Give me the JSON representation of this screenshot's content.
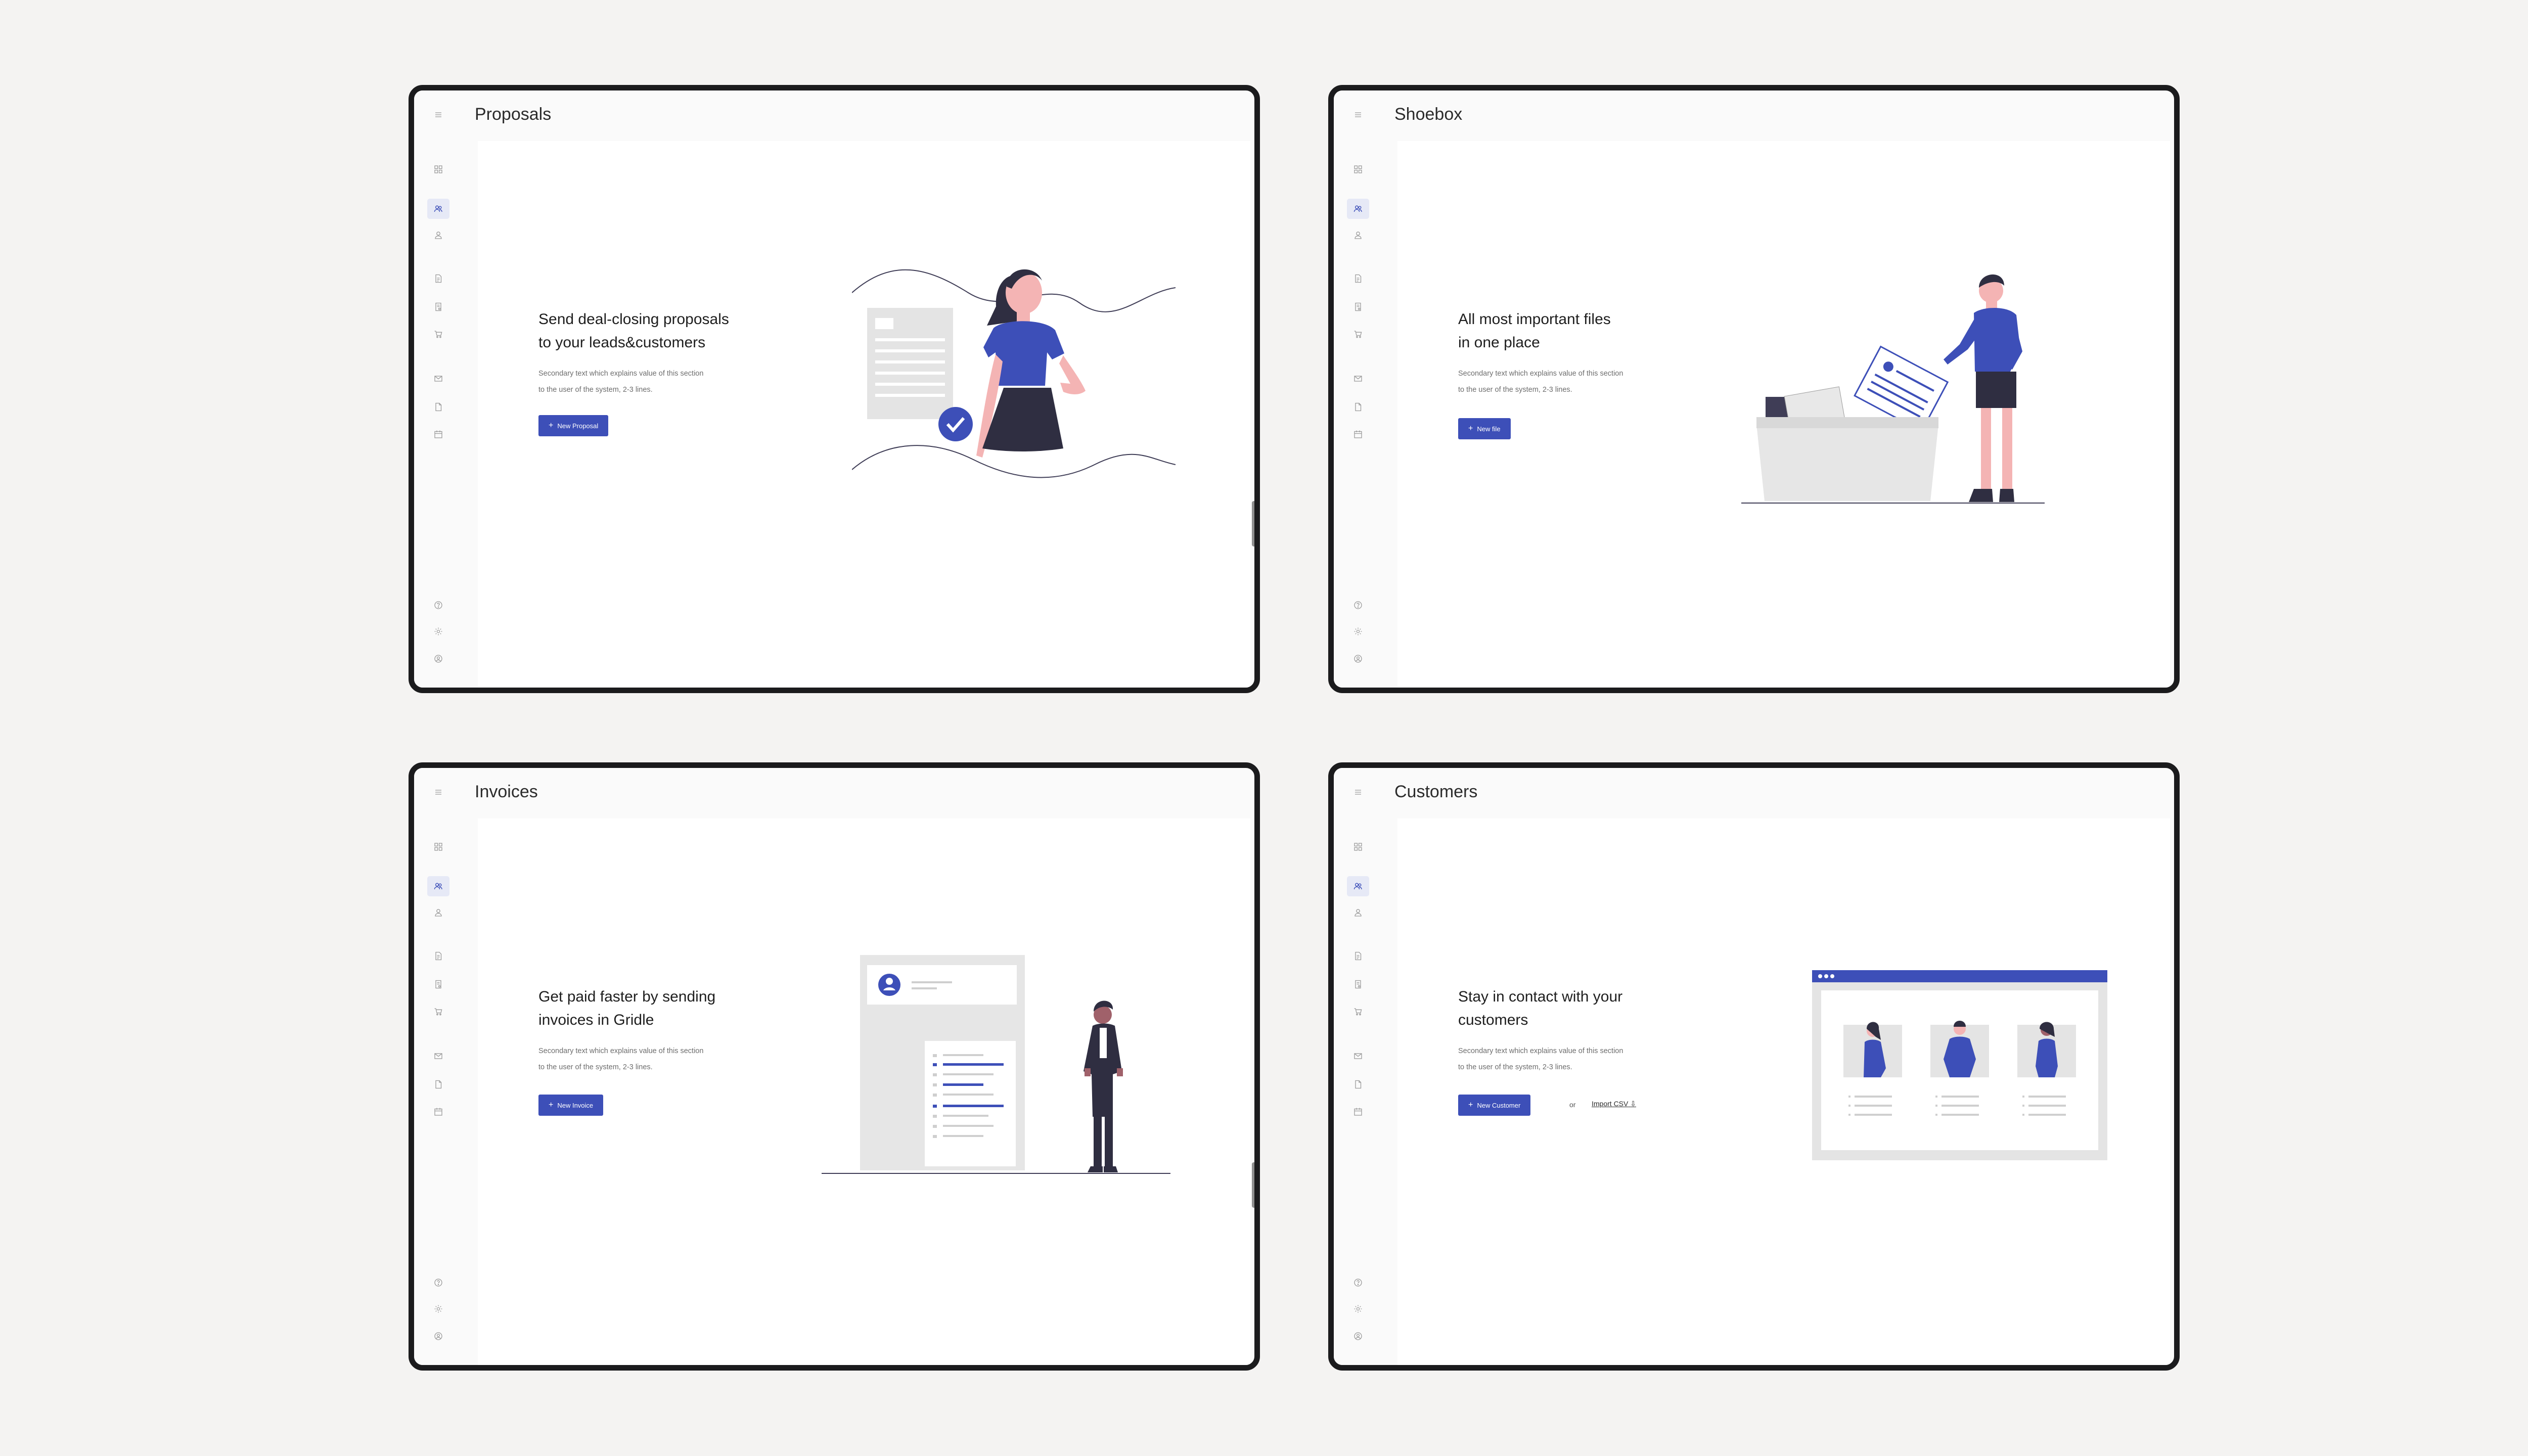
{
  "screens": [
    {
      "title": "Proposals",
      "headline": [
        "Send deal-closing proposals",
        "to your leads&customers"
      ],
      "secondary": [
        "Secondary text which explains value of this section",
        "to the user of the system, 2-3 lines."
      ],
      "button_label": "New Proposal"
    },
    {
      "title": "Shoebox",
      "headline": [
        "All most important files",
        "in one place"
      ],
      "secondary": [
        "Secondary text which explains value of this section",
        "to the user of the system, 2-3 lines."
      ],
      "button_label": "New file"
    },
    {
      "title": "Invoices",
      "headline": [
        "Get paid faster by sending",
        "invoices in Gridle"
      ],
      "secondary": [
        "Secondary text which explains value of this section",
        "to the user of the system, 2-3 lines."
      ],
      "button_label": "New Invoice"
    },
    {
      "title": "Customers",
      "headline": [
        "Stay in contact with your",
        "customers"
      ],
      "secondary": [
        "Secondary text which explains value of this section",
        "to the user of the system, 2-3 lines."
      ],
      "button_label": "New Customer",
      "or_text": "or",
      "import_label": "Import CSV"
    }
  ],
  "sidebar_icons": [
    "menu-icon",
    "dashboard-icon",
    "users-icon",
    "user-icon",
    "document-icon",
    "invoice-icon",
    "cart-icon",
    "mail-icon",
    "file-icon",
    "calendar-icon",
    "help-icon",
    "settings-icon",
    "account-icon"
  ],
  "colors": {
    "accent": "#3d4fb8",
    "frame": "#1b1b1d",
    "background": "#f4f3f2",
    "skin": "#f4b4b4"
  }
}
